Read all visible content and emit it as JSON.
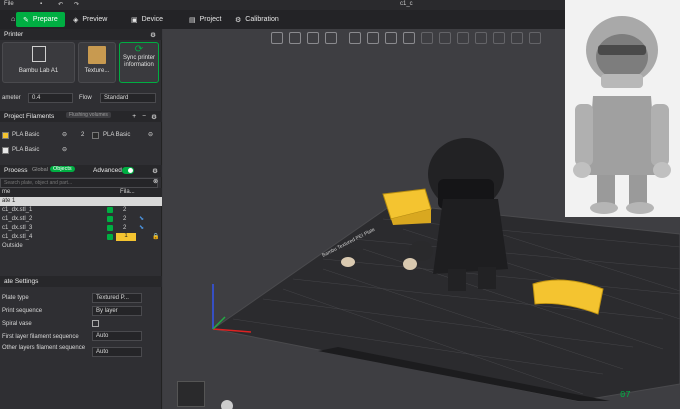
{
  "titlebar": {
    "file": "File",
    "title": "c1_c"
  },
  "nav": {
    "prepare": "Prepare",
    "preview": "Preview",
    "device": "Device",
    "project": "Project",
    "calibration": "Calibration"
  },
  "printer": {
    "section": "Printer",
    "printer_name": "Bambu Lab A1",
    "plate_label": "Texture...",
    "sync_label": "Sync printer information",
    "diameter_label": "ameter",
    "diameter_value": "0.4",
    "flow_label": "Flow",
    "flow_value": "Standard"
  },
  "filaments": {
    "section": "Project Filaments",
    "flushing": "Flushing volumes",
    "items": [
      {
        "num": "1",
        "name": "PLA Basic",
        "color": "#f4c430"
      },
      {
        "num": "2",
        "name": "PLA Basic",
        "color": "#2b2b2b"
      },
      {
        "num": "3",
        "name": "PLA Basic",
        "color": "#e8e8e8"
      }
    ]
  },
  "process": {
    "section": "Process",
    "global": "Global",
    "objects": "Objects",
    "advanced": "Advanced",
    "search_placeholder": "Search plate, object and part...",
    "col_name": "me",
    "col_fil": "Fila...",
    "plate": "ate 1",
    "objects_list": [
      {
        "name": "c1_dx.stl_1",
        "fil": "2"
      },
      {
        "name": "c1_dx.stl_2",
        "fil": "2"
      },
      {
        "name": "c1_dx.stl_3",
        "fil": "2"
      },
      {
        "name": "c1_dx.stl_4",
        "fil": "1"
      }
    ],
    "outside": "Outside"
  },
  "plate_settings": {
    "section": "ate Settings",
    "rows": [
      {
        "label": "Plate type",
        "value": "Textured P..."
      },
      {
        "label": "Print sequence",
        "value": "By layer"
      },
      {
        "label": "Spiral vase",
        "value": ""
      },
      {
        "label": "First layer filament sequence",
        "value": "Auto"
      },
      {
        "label": "Other layers filament sequence",
        "value": "Auto"
      }
    ]
  },
  "viewport": {
    "plate_number": "07",
    "bed_brand": "Bambu Textured PEI Plate"
  },
  "colors": {
    "accent": "#00ae42",
    "yellow": "#f4c430",
    "dark_model": "#222224",
    "bed": "#2e2e30"
  }
}
